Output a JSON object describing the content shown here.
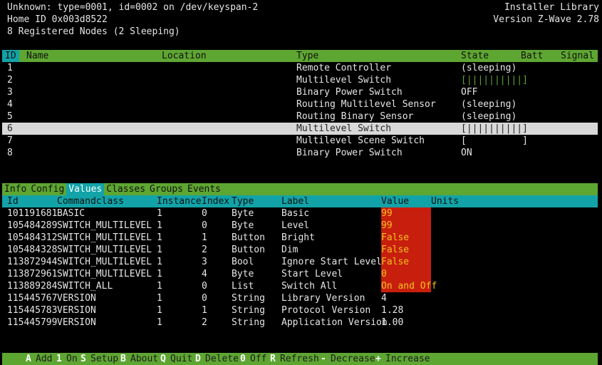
{
  "header": {
    "device_line": "Unknown: type=0001, id=0002 on /dev/keyspan-2",
    "home_id": "Home ID 0x003d8522",
    "registered": "8 Registered Nodes (2 Sleeping)",
    "library": "Installer Library",
    "version": "Version Z-Wave 2.78"
  },
  "nodes": {
    "columns": {
      "id": "ID",
      "name": "Name",
      "location": "Location",
      "type": "Type",
      "state": "State",
      "batt": "Batt",
      "signal": "Signal"
    },
    "rows": [
      {
        "id": "1",
        "type": "Remote Controller",
        "state": "(sleeping)"
      },
      {
        "id": "2",
        "type": "Multilevel Switch",
        "state": "[||||||||||]"
      },
      {
        "id": "3",
        "type": "Binary Power Switch",
        "state": "OFF"
      },
      {
        "id": "4",
        "type": "Routing Multilevel Sensor",
        "state": "(sleeping)"
      },
      {
        "id": "5",
        "type": "Routing Binary Sensor",
        "state": "(sleeping)"
      },
      {
        "id": "6",
        "type": "Multilevel Switch",
        "state": "[||||||||||]"
      },
      {
        "id": "7",
        "type": "Multilevel Scene Switch",
        "state": "[          ]"
      },
      {
        "id": "8",
        "type": "Binary Power Switch",
        "state": "ON"
      }
    ]
  },
  "tabs": [
    "Info",
    "Config",
    "Values",
    "Classes",
    "Groups",
    "Events"
  ],
  "values": {
    "columns": {
      "id": "Id",
      "cc": "Commandclass",
      "instance": "Instance",
      "index": "Index",
      "type": "Type",
      "label": "Label",
      "value": "Value",
      "units": "Units"
    },
    "rows": [
      {
        "id": "101191681",
        "cc": "BASIC",
        "instance": "1",
        "index": "0",
        "type": "Byte",
        "label": "Basic",
        "value": "99",
        "writable": true
      },
      {
        "id": "105484289",
        "cc": "SWITCH_MULTILEVEL",
        "instance": "1",
        "index": "0",
        "type": "Byte",
        "label": "Level",
        "value": "99",
        "writable": true
      },
      {
        "id": "105484312",
        "cc": "SWITCH_MULTILEVEL",
        "instance": "1",
        "index": "1",
        "type": "Button",
        "label": "Bright",
        "value": "False",
        "writable": true
      },
      {
        "id": "105484328",
        "cc": "SWITCH_MULTILEVEL",
        "instance": "1",
        "index": "2",
        "type": "Button",
        "label": "Dim",
        "value": "False",
        "writable": true
      },
      {
        "id": "113872944",
        "cc": "SWITCH_MULTILEVEL",
        "instance": "1",
        "index": "3",
        "type": "Bool",
        "label": "Ignore Start Level",
        "value": "False",
        "writable": true
      },
      {
        "id": "113872961",
        "cc": "SWITCH_MULTILEVEL",
        "instance": "1",
        "index": "4",
        "type": "Byte",
        "label": "Start Level",
        "value": "0",
        "writable": true
      },
      {
        "id": "113889284",
        "cc": "SWITCH_ALL",
        "instance": "1",
        "index": "0",
        "type": "List",
        "label": "Switch All",
        "value": "On and Off",
        "writable": true
      },
      {
        "id": "115445767",
        "cc": "VERSION",
        "instance": "1",
        "index": "0",
        "type": "String",
        "label": "Library Version",
        "value": "4",
        "writable": false
      },
      {
        "id": "115445783",
        "cc": "VERSION",
        "instance": "1",
        "index": "1",
        "type": "String",
        "label": "Protocol Version",
        "value": "1.28",
        "writable": false
      },
      {
        "id": "115445799",
        "cc": "VERSION",
        "instance": "1",
        "index": "2",
        "type": "String",
        "label": "Application Version",
        "value": "1.00",
        "writable": false
      }
    ]
  },
  "keys": [
    {
      "key": "A",
      "label": "Add"
    },
    {
      "key": "1",
      "label": "On"
    },
    {
      "key": "S",
      "label": "Setup"
    },
    {
      "key": "B",
      "label": "About"
    },
    {
      "key": "Q",
      "label": "Quit"
    },
    {
      "key": "D",
      "label": "Delete"
    },
    {
      "key": "0",
      "label": "Off"
    },
    {
      "key": "R",
      "label": "Refresh"
    },
    {
      "key": "-",
      "label": "Decrease"
    },
    {
      "key": "+",
      "label": "Increase"
    }
  ],
  "colors": {
    "green": "#5ea632",
    "teal": "#12a3a8",
    "value_bg": "#c81e0d",
    "value_fg": "#f0c020",
    "selection": "#d8d8d8"
  }
}
